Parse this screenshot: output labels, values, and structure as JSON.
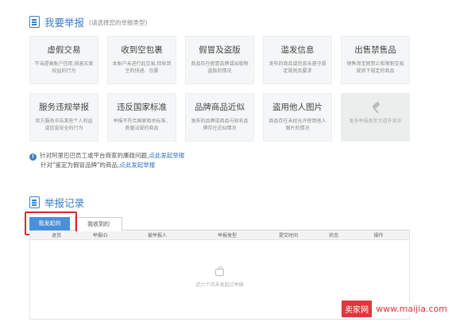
{
  "report": {
    "title": "我要举报",
    "subtitle": "(请选择您的举报类型)"
  },
  "cards_row1": [
    {
      "title": "虚假交易",
      "desc": "不当提高账户信用,损害买家权益的行为"
    },
    {
      "title": "收到空包裹",
      "desc": "本账户未进行此交易,但收到空的快递、包裹"
    },
    {
      "title": "假冒及盗版",
      "desc": "商品存在假冒品牌或出版物盗版的情况"
    },
    {
      "title": "滥发信息",
      "desc": "发布的商品或信息未遵守规定规则及要求"
    },
    {
      "title": "出售禁售品",
      "desc": "销售淘宝网禁止和限制交易规则下规定的商品"
    }
  ],
  "cards_row2": [
    {
      "title": "服务违规举报",
      "desc": "官方服务中告某些个人利益或信息安全的行为"
    },
    {
      "title": "违反国家标准",
      "desc": "举报不符合国家相关标准、质量法规的商品"
    },
    {
      "title": "品牌商品近似",
      "desc": "发布的品牌或商品与知名品牌存在近似情况"
    },
    {
      "title": "盗用他人图片",
      "desc": "商品存在未经允许使用他人图片的情况"
    }
  ],
  "disabled_card": {
    "icon": "gavel-icon",
    "desc": "更多举报类型大道开发中"
  },
  "notice": {
    "line1_text": "针对阿里巴巴员工或平台商家的廉政问题,",
    "line1_link": "点此发起举报",
    "line2_text": "针对\"鉴定为假冒品牌\"的商品,",
    "line2_link": "点此发起举报"
  },
  "records": {
    "title": "举报记录",
    "tabs": [
      "我发起的",
      "我收到的"
    ],
    "columns": [
      "退货",
      "举报ID",
      "被举报人",
      "举报类型",
      "提交时间",
      "状态",
      "操作"
    ],
    "empty_text": "近六个月未发起过举报"
  },
  "watermark": {
    "brand": "卖家网",
    "url": "www.maijia.com"
  },
  "colors": {
    "accent": "#3a7fc2",
    "tab_active": "#4a90d9",
    "highlight": "#d9282f",
    "watermark": "#e0363d"
  }
}
